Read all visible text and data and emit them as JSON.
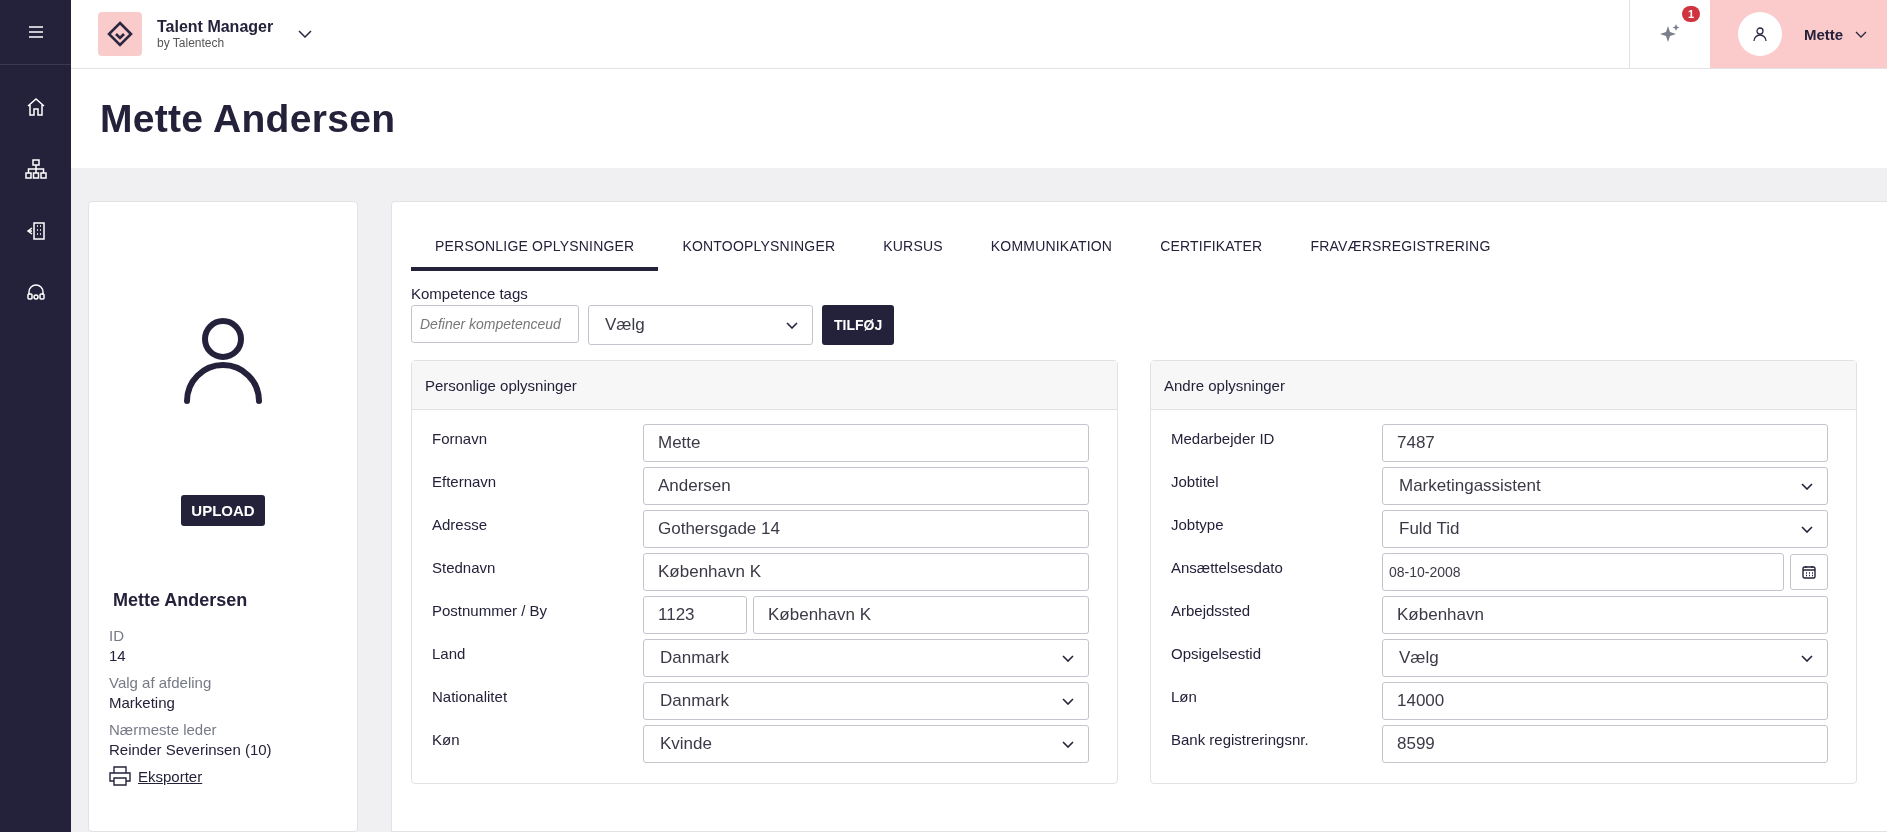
{
  "header": {
    "app_title": "Talent Manager",
    "app_subtitle": "by Talentech",
    "notification_count": "1",
    "user_name": "Mette"
  },
  "page_title": "Mette Andersen",
  "profile": {
    "upload_button": "UPLOAD",
    "name": "Mette Andersen",
    "details": [
      {
        "label": "ID",
        "value": "14"
      },
      {
        "label": "Valg af afdeling",
        "value": "Marketing"
      },
      {
        "label": "Nærmeste leder",
        "value": "Reinder Severinsen (10)"
      }
    ],
    "export_link": "Eksporter"
  },
  "tabs": [
    {
      "label": "PERSONLIGE OPLYSNINGER",
      "selected": true
    },
    {
      "label": "KONTOOPLYSNINGER",
      "selected": false
    },
    {
      "label": "KURSUS",
      "selected": false
    },
    {
      "label": "KOMMUNIKATION",
      "selected": false
    },
    {
      "label": "CERTIFIKATER",
      "selected": false
    },
    {
      "label": "FRAVÆRSREGISTRERING",
      "selected": false
    }
  ],
  "competence": {
    "label": "Kompetence tags",
    "placeholder": "Definer kompetenceud",
    "select_value": "Vælg",
    "button": "TILFØJ"
  },
  "panels": [
    {
      "title": "Personlige oplysninger",
      "fields": [
        {
          "label": "Fornavn",
          "kind": "text",
          "value": "Mette"
        },
        {
          "label": "Efternavn",
          "kind": "text",
          "value": "Andersen"
        },
        {
          "label": "Adresse",
          "kind": "text",
          "value": "Gothersgade 14"
        },
        {
          "label": "Stednavn",
          "kind": "text",
          "value": "København K"
        },
        {
          "label": "Postnummer / By",
          "kind": "pair",
          "values": [
            "1123",
            "København K"
          ]
        },
        {
          "label": "Land",
          "kind": "select",
          "value": "Danmark"
        },
        {
          "label": "Nationalitet",
          "kind": "select",
          "value": "Danmark"
        },
        {
          "label": "Køn",
          "kind": "select",
          "value": "Kvinde"
        }
      ]
    },
    {
      "title": "Andre oplysninger",
      "fields": [
        {
          "label": "Medarbejder ID",
          "kind": "text",
          "value": "7487"
        },
        {
          "label": "Jobtitel",
          "kind": "select",
          "value": "Marketingassistent"
        },
        {
          "label": "Jobtype",
          "kind": "select",
          "value": "Fuld Tid"
        },
        {
          "label": "Ansættelsesdato",
          "kind": "date",
          "value": "08-10-2008"
        },
        {
          "label": "Arbejdssted",
          "kind": "text",
          "value": "København"
        },
        {
          "label": "Opsigelsestid",
          "kind": "select",
          "value": "Vælg"
        },
        {
          "label": "Løn",
          "kind": "text",
          "value": "14000"
        },
        {
          "label": "Bank registreringsnr.",
          "kind": "text",
          "value": "8599"
        }
      ]
    }
  ]
}
